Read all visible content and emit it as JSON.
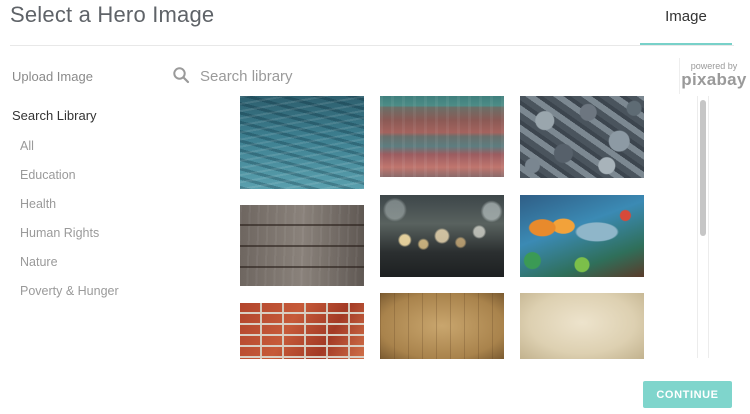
{
  "header": {
    "title": "Select a Hero Image",
    "tabs": [
      {
        "label": "Image",
        "active": true
      }
    ]
  },
  "sidebar": {
    "upload_label": "Upload Image",
    "search_label": "Search Library",
    "categories": [
      "All",
      "Education",
      "Health",
      "Human Rights",
      "Nature",
      "Poverty & Hunger"
    ]
  },
  "search": {
    "placeholder": "Search library",
    "value": "",
    "icon": "search-icon"
  },
  "provider": {
    "small": "powered by",
    "name": "pixabay"
  },
  "gallery": [
    {
      "subject": "water"
    },
    {
      "subject": "painted planks"
    },
    {
      "subject": "stones"
    },
    {
      "subject": "wood boards"
    },
    {
      "subject": "bokeh"
    },
    {
      "subject": "fish mural"
    },
    {
      "subject": "bricks"
    },
    {
      "subject": "cardboard"
    },
    {
      "subject": "paper"
    }
  ],
  "footer": {
    "continue_label": "CONTINUE"
  },
  "colors": {
    "accent": "#7fd5cc",
    "tab_underline": "#78d1c9",
    "title_text": "#5f6368",
    "muted_text": "#9a9a9a"
  }
}
